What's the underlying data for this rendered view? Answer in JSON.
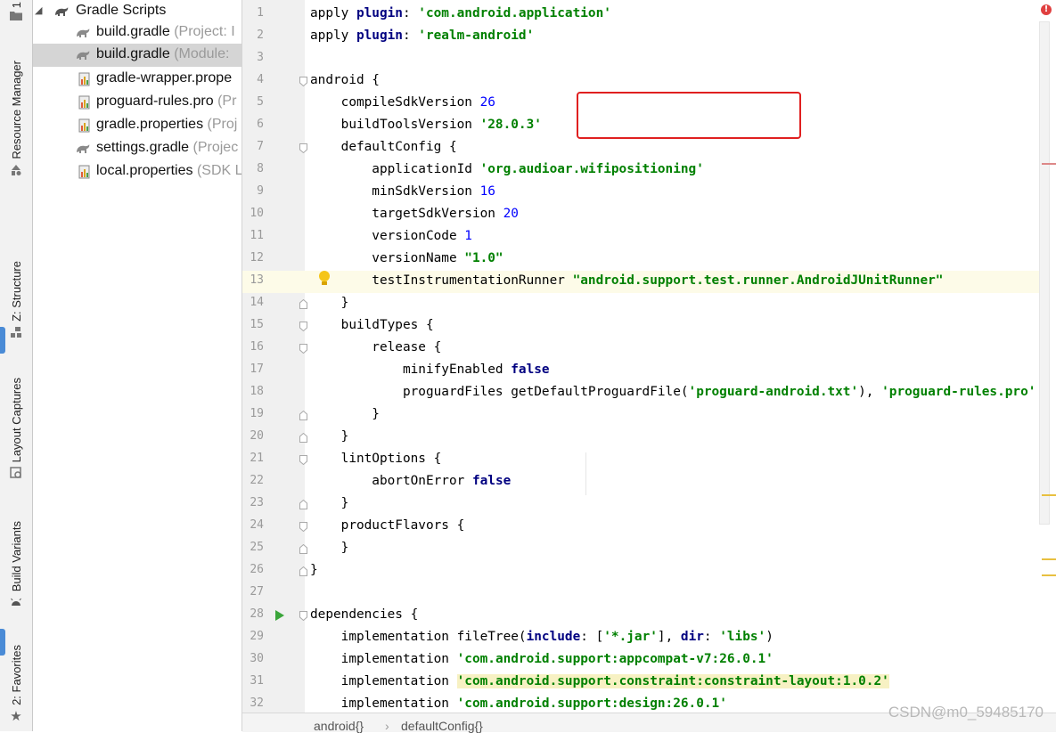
{
  "tool_strip": {
    "tabs": [
      {
        "label": "Resource Manager",
        "icon": "resource-manager-icon"
      },
      {
        "label": "Z: Structure",
        "icon": "structure-icon"
      },
      {
        "label": "Layout Captures",
        "icon": "layout-captures-icon"
      },
      {
        "label": "Build Variants",
        "icon": "android-icon"
      },
      {
        "label": "2: Favorites",
        "icon": "star-icon"
      }
    ],
    "top_label": "1"
  },
  "project_tree": {
    "items": [
      {
        "label": "Gradle Scripts",
        "hint": "",
        "icon": "gradle-icon",
        "expanded": true,
        "selected": false
      },
      {
        "label": "build.gradle",
        "hint": "(Project: I",
        "icon": "gradle-icon",
        "selected": false
      },
      {
        "label": "build.gradle",
        "hint": "(Module:",
        "icon": "gradle-icon",
        "selected": true
      },
      {
        "label": "gradle-wrapper.prope",
        "hint": "",
        "icon": "properties-file-icon",
        "selected": false
      },
      {
        "label": "proguard-rules.pro",
        "hint": "(Pr",
        "icon": "properties-file-icon",
        "selected": false
      },
      {
        "label": "gradle.properties",
        "hint": "(Proj",
        "icon": "properties-file-icon",
        "selected": false
      },
      {
        "label": "settings.gradle",
        "hint": "(Projec",
        "icon": "gradle-icon",
        "selected": false
      },
      {
        "label": "local.properties",
        "hint": "(SDK L",
        "icon": "properties-file-icon",
        "selected": false
      }
    ]
  },
  "editor": {
    "current_line": 13,
    "lines": [
      {
        "n": "1",
        "tokens": [
          [
            "nm",
            "apply "
          ],
          [
            "kw",
            "plugin"
          ],
          [
            "nm",
            ": "
          ],
          [
            "str",
            "'com.android.application'"
          ]
        ]
      },
      {
        "n": "2",
        "tokens": [
          [
            "nm",
            "apply "
          ],
          [
            "kw",
            "plugin"
          ],
          [
            "nm",
            ": "
          ],
          [
            "str",
            "'realm-android'"
          ]
        ]
      },
      {
        "n": "3",
        "tokens": []
      },
      {
        "n": "4",
        "tokens": [
          [
            "nm",
            "android {"
          ]
        ]
      },
      {
        "n": "5",
        "tokens": [
          [
            "nm",
            "    compileSdkVersion "
          ],
          [
            "num",
            "26"
          ]
        ]
      },
      {
        "n": "6",
        "tokens": [
          [
            "nm",
            "    buildToolsVersion "
          ],
          [
            "str",
            "'28.0.3'"
          ]
        ]
      },
      {
        "n": "7",
        "tokens": [
          [
            "nm",
            "    defaultConfig {"
          ]
        ]
      },
      {
        "n": "8",
        "tokens": [
          [
            "nm",
            "        applicationId "
          ],
          [
            "str",
            "'org.audioar.wifipositioning'"
          ]
        ]
      },
      {
        "n": "9",
        "tokens": [
          [
            "nm",
            "        minSdkVersion "
          ],
          [
            "num",
            "16"
          ]
        ]
      },
      {
        "n": "10",
        "tokens": [
          [
            "nm",
            "        targetSdkVersion "
          ],
          [
            "num",
            "20"
          ]
        ]
      },
      {
        "n": "11",
        "tokens": [
          [
            "nm",
            "        versionCode "
          ],
          [
            "num",
            "1"
          ]
        ]
      },
      {
        "n": "12",
        "tokens": [
          [
            "nm",
            "        versionName "
          ],
          [
            "str",
            "\"1.0\""
          ]
        ]
      },
      {
        "n": "13",
        "tokens": [
          [
            "nm",
            "        testInstrumentationRunner "
          ],
          [
            "str",
            "\"android.support.test.runner.AndroidJUnitRunner\""
          ]
        ]
      },
      {
        "n": "14",
        "tokens": [
          [
            "nm",
            "    }"
          ]
        ]
      },
      {
        "n": "15",
        "tokens": [
          [
            "nm",
            "    buildTypes {"
          ]
        ]
      },
      {
        "n": "16",
        "tokens": [
          [
            "nm",
            "        release {"
          ]
        ]
      },
      {
        "n": "17",
        "tokens": [
          [
            "nm",
            "            minifyEnabled "
          ],
          [
            "kw",
            "false"
          ]
        ]
      },
      {
        "n": "18",
        "tokens": [
          [
            "nm",
            "            proguardFiles getDefaultProguardFile("
          ],
          [
            "str",
            "'proguard-android.txt'"
          ],
          [
            "nm",
            "), "
          ],
          [
            "str",
            "'proguard-rules.pro'"
          ]
        ]
      },
      {
        "n": "19",
        "tokens": [
          [
            "nm",
            "        }"
          ]
        ]
      },
      {
        "n": "20",
        "tokens": [
          [
            "nm",
            "    }"
          ]
        ]
      },
      {
        "n": "21",
        "tokens": [
          [
            "nm",
            "    lintOptions {"
          ]
        ]
      },
      {
        "n": "22",
        "tokens": [
          [
            "nm",
            "        abortOnError "
          ],
          [
            "kw",
            "false"
          ]
        ]
      },
      {
        "n": "23",
        "tokens": [
          [
            "nm",
            "    }"
          ]
        ]
      },
      {
        "n": "24",
        "tokens": [
          [
            "nm",
            "    productFlavors {"
          ]
        ]
      },
      {
        "n": "25",
        "tokens": [
          [
            "nm",
            "    }"
          ]
        ]
      },
      {
        "n": "26",
        "tokens": [
          [
            "nm",
            "}"
          ]
        ]
      },
      {
        "n": "27",
        "tokens": []
      },
      {
        "n": "28",
        "tokens": [
          [
            "nm",
            "dependencies {"
          ]
        ]
      },
      {
        "n": "29",
        "tokens": [
          [
            "nm",
            "    implementation fileTree("
          ],
          [
            "kw",
            "include"
          ],
          [
            "nm",
            ": ["
          ],
          [
            "str",
            "'*.jar'"
          ],
          [
            "nm",
            "], "
          ],
          [
            "kw",
            "dir"
          ],
          [
            "nm",
            ": "
          ],
          [
            "str",
            "'libs'"
          ],
          [
            "nm",
            ")"
          ]
        ]
      },
      {
        "n": "30",
        "tokens": [
          [
            "nm",
            "    implementation "
          ],
          [
            "str",
            "'com.android.support:appcompat-v7:26.0.1'"
          ]
        ]
      },
      {
        "n": "31",
        "tokens": [
          [
            "nm",
            "    implementation "
          ],
          [
            "hl-str",
            "'com.android.support.constraint:constraint-layout:1.0.2'"
          ]
        ]
      },
      {
        "n": "32",
        "tokens": [
          [
            "nm",
            "    implementation "
          ],
          [
            "str",
            "'com.android.support:design:26.0.1'"
          ]
        ]
      }
    ]
  },
  "breadcrumbs": {
    "first": "android{}",
    "separator": "›",
    "second": "defaultConfig{}"
  },
  "watermark": "CSDN@m0_59485170",
  "colors": {
    "highlight_box": "#e02020",
    "keyword": "#000080",
    "string": "#008000",
    "number": "#0000ff"
  }
}
